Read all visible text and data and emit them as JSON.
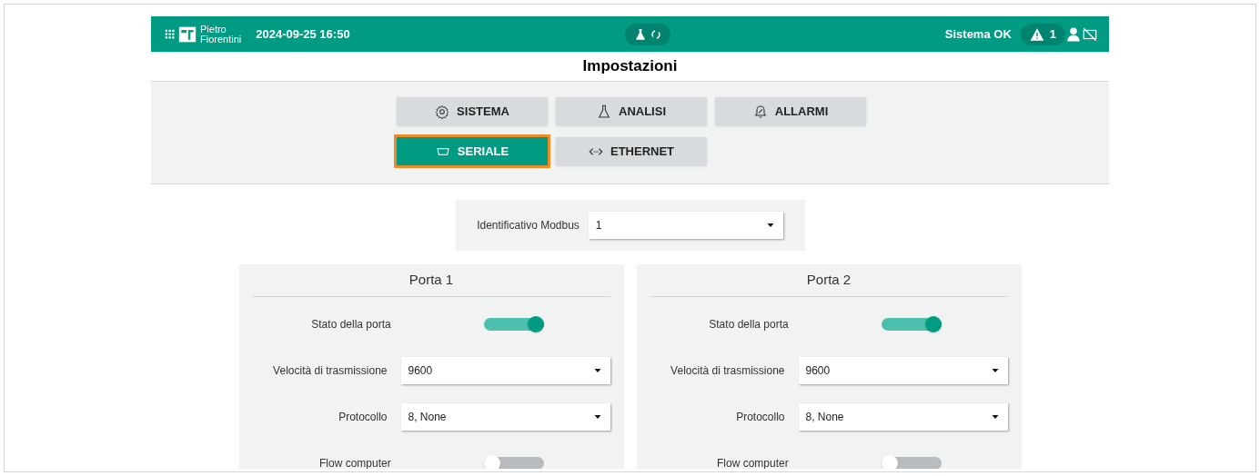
{
  "header": {
    "brand_line_1": "Pietro",
    "brand_line_2": "Fiorentini",
    "datetime": "2024-09-25 16:50",
    "status": "Sistema OK",
    "alarm_count": "1"
  },
  "title": "Impostazioni",
  "tabs": [
    {
      "label": "SISTEMA",
      "kind": "gear",
      "selected": false
    },
    {
      "label": "ANALISI",
      "kind": "flask",
      "selected": false
    },
    {
      "label": "ALLARMI",
      "kind": "bell",
      "selected": false
    },
    {
      "label": "SERIALE",
      "kind": "serial",
      "selected": true
    },
    {
      "label": "ETHERNET",
      "kind": "code",
      "selected": false
    }
  ],
  "modbus": {
    "label": "Identificativo Modbus",
    "value": "1"
  },
  "ports": [
    {
      "title": "Porta 1",
      "rows": [
        {
          "kind": "toggle",
          "label": "Stato della porta",
          "on": true
        },
        {
          "kind": "select",
          "label": "Velocità di trasmissione",
          "value": "9600"
        },
        {
          "kind": "select",
          "label": "Protocollo",
          "value": "8, None"
        },
        {
          "kind": "toggle",
          "label": "Flow computer",
          "on": false
        }
      ]
    },
    {
      "title": "Porta 2",
      "rows": [
        {
          "kind": "toggle",
          "label": "Stato della porta",
          "on": true
        },
        {
          "kind": "select",
          "label": "Velocità di trasmissione",
          "value": "9600"
        },
        {
          "kind": "select",
          "label": "Protocollo",
          "value": "8, None"
        },
        {
          "kind": "toggle",
          "label": "Flow computer",
          "on": false
        }
      ]
    }
  ]
}
